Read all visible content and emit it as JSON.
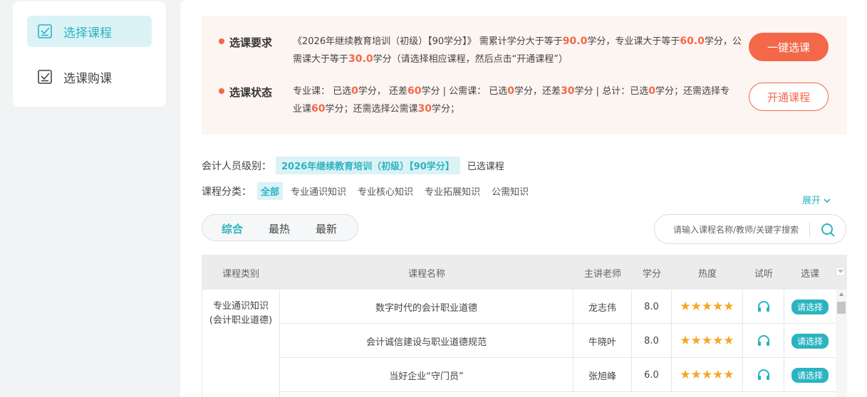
{
  "sidebar": {
    "items": [
      {
        "label": "选择课程",
        "active": true,
        "icon": "checkbox-icon"
      },
      {
        "label": "选课购课",
        "active": false,
        "icon": "checkbox-icon"
      }
    ]
  },
  "requirement": {
    "req_title": "选课要求",
    "req_text_1": "《2026年继续教育培训（初级）【90学分】》 需累计学分大于等于",
    "req_total": "90.0",
    "req_text_2": "学分，专业课大于等于",
    "req_major": "60.0",
    "req_text_3": "学分，公需课大于等于",
    "req_public": "30.0",
    "req_text_4": "学分（请选择相应课程，然后点击“开通课程”）",
    "status_title": "选课状态",
    "st_1": "专业课： 已选",
    "st_major_sel": "0",
    "st_2": "学分， 还差",
    "st_major_left": "60",
    "st_3": "学分 | 公需课： 已选",
    "st_public_sel": "0",
    "st_4": "学分，还差",
    "st_public_left": "30",
    "st_5": "学分 | 总计：已选",
    "st_total_sel": "0",
    "st_6": "学分；还需选择专业课",
    "st_need_major": "60",
    "st_7": "学分；还需选择公需课",
    "st_need_public": "30",
    "st_8": "学分；",
    "btn_one_click": "一键选课",
    "btn_open": "开通课程"
  },
  "filters": {
    "level_label": "会计人员级别：",
    "level_value": "2026年继续教育培训（初级）【90学分】",
    "level_chosen": "已选课程",
    "cat_label": "课程分类：",
    "categories": [
      "全部",
      "专业通识知识",
      "专业核心知识",
      "专业拓展知识",
      "公需知识"
    ],
    "expand": "展开"
  },
  "sort": {
    "items": [
      "综合",
      "最热",
      "最新"
    ]
  },
  "search": {
    "placeholder": "请输入课程名称/教师/关键字搜索"
  },
  "table": {
    "headers": [
      "课程类别",
      "课程名称",
      "主讲老师",
      "学分",
      "热度",
      "试听",
      "选课"
    ],
    "category": "专业通识知识(会计职业道德)",
    "rows": [
      {
        "name": "数字时代的会计职业道德",
        "teacher": "龙志伟",
        "credit": "8.0",
        "stars": "★★★★★",
        "rating": 5,
        "pick": "请选择"
      },
      {
        "name": "会计诚信建设与职业道德规范",
        "teacher": "牛晓叶",
        "credit": "8.0",
        "stars": "★★★★★",
        "rating": 5,
        "pick": "请选择"
      },
      {
        "name": "当好企业“守门员”",
        "teacher": "张旭峰",
        "credit": "6.0",
        "stars": "★★★★★",
        "rating": 5,
        "pick": "请选择"
      }
    ]
  },
  "colors": {
    "accent": "#2bb3c0",
    "orange": "#f26849",
    "star": "#f5a623"
  }
}
